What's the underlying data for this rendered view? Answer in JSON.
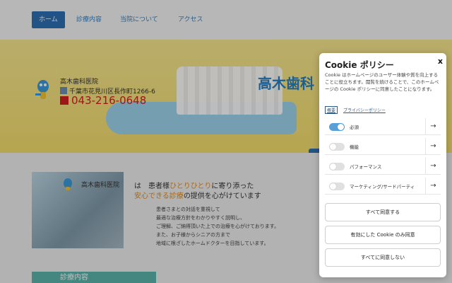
{
  "nav": {
    "items": [
      "ホーム",
      "診療内容",
      "当院について",
      "アクセス"
    ]
  },
  "hero": {
    "title": "高木歯科",
    "clinic_name": "高木歯科医院",
    "address": "千葉市花見川区長作町1266-6",
    "phone": "043-216-0648"
  },
  "info": {
    "clinic_name": "高木歯科医院",
    "headline_1a": "は　患者様",
    "headline_1b": "ひとりひとり",
    "headline_1c": "に寄り添った",
    "headline_2a": "安心できる診療",
    "headline_2b": "の提供を心がけています",
    "body": [
      "患者さまとの対話を重視して",
      "最適な治療方針をわかりやすく説明し、",
      "ご理解、ご納得頂いた上での治療を心がけております。",
      "また、お子様からシニアの方まで",
      "地域に根ざしたホームドクターを目指しています。"
    ],
    "section_label": "診療内容"
  },
  "cookie": {
    "title": "Cookie ポリシー",
    "close": "x",
    "description": "Cookie はホームページのユーザー体験や質を向上することに役立ちます。閲覧を続けることで、このホームページの Cookie ポリシーに同意したことになります。",
    "link_summary": "概要",
    "link_privacy": "プライバシーポリシー",
    "categories": [
      {
        "label": "必須",
        "enabled": true
      },
      {
        "label": "機能",
        "enabled": false
      },
      {
        "label": "パフォーマンス",
        "enabled": false
      },
      {
        "label": "マーケティング/サードパーティ",
        "enabled": false
      }
    ],
    "arrow": "→",
    "buttons": {
      "accept_all": "すべて同意する",
      "accept_enabled": "有効にした Cookie のみ同意",
      "reject_all": "すべてに同意しない"
    }
  }
}
